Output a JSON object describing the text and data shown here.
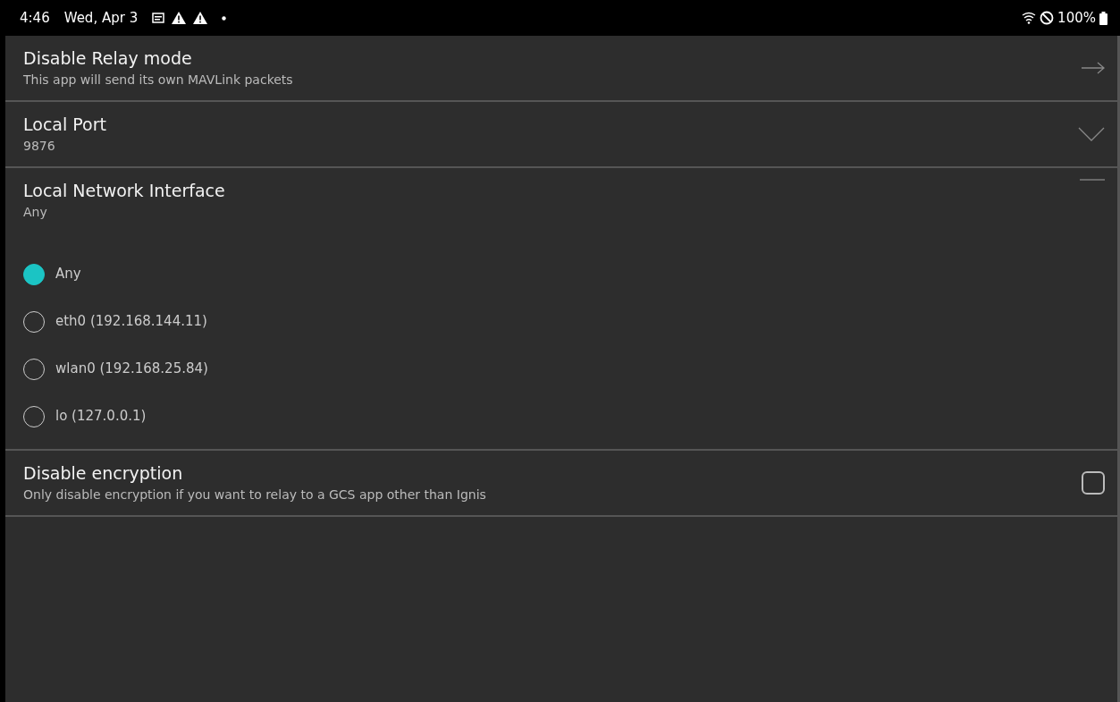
{
  "status_bar": {
    "time": "4:46",
    "date": "Wed, Apr 3",
    "battery": "100%"
  },
  "settings": [
    {
      "kind": "link",
      "title": "Disable Relay mode",
      "summary": "This app will send its own MAVLink packets"
    },
    {
      "kind": "select",
      "title": "Local Port",
      "summary": "9876",
      "expanded": false
    },
    {
      "kind": "select",
      "title": "Local Network Interface",
      "summary": "Any",
      "expanded": true,
      "options": [
        {
          "label": "Any",
          "selected": true
        },
        {
          "label": "eth0 (192.168.144.11)",
          "selected": false
        },
        {
          "label": "wlan0 (192.168.25.84)",
          "selected": false
        },
        {
          "label": "lo (127.0.0.1)",
          "selected": false
        }
      ]
    },
    {
      "kind": "checkbox",
      "title": "Disable encryption",
      "summary": "Only disable encryption if you want to relay to a GCS app other than Ignis",
      "checked": false
    }
  ]
}
